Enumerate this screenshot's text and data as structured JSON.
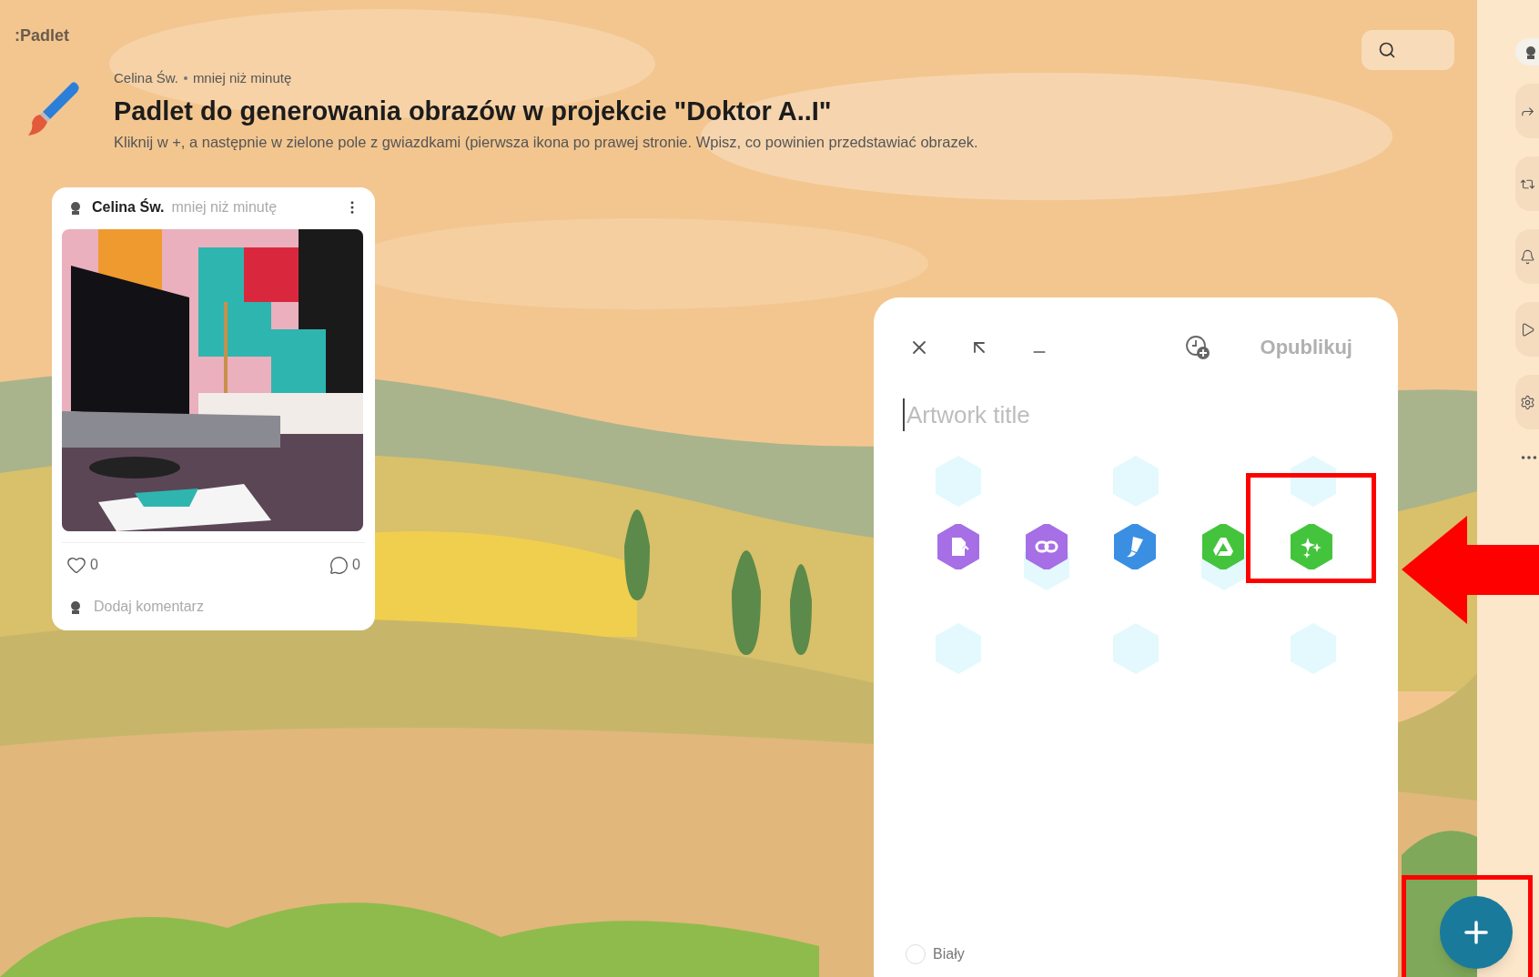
{
  "logo": ":Padlet",
  "header": {
    "author": "Celina Św.",
    "time": "mniej niż minutę",
    "title": "Padlet do generowania obrazów w projekcie \"Doktor A..I\"",
    "description": "Kliknij w +, a następnie w zielone pole z gwiazdkami (pierwsza ikona po prawej stronie. Wpisz, co powinien przedstawiać obrazek."
  },
  "posts": [
    {
      "author": "Celina Św.",
      "time": "mniej niż minutę",
      "likes": "0",
      "comments": "0",
      "comment_placeholder": "Dodaj komentarz"
    }
  ],
  "composer": {
    "publish": {
      "label": "Opublikuj",
      "disabled": true
    },
    "title_field": {
      "placeholder": "Artwork title"
    },
    "attachments": [
      {
        "kind": "upload",
        "color": "#a66fe6",
        "highlighted": false
      },
      {
        "kind": "link",
        "color": "#a66fe6",
        "highlighted": false
      },
      {
        "kind": "draw",
        "color": "#3a8fe3",
        "highlighted": false
      },
      {
        "kind": "drive",
        "color": "#44c43c",
        "highlighted": false
      },
      {
        "kind": "ai",
        "color": "#44c43c",
        "highlighted": true
      }
    ],
    "color_option": {
      "label": "Biały",
      "selected": false
    }
  },
  "sidebar": {
    "items": [
      {
        "kind": "avatar"
      },
      {
        "kind": "share"
      },
      {
        "kind": "remix"
      },
      {
        "kind": "notifications"
      },
      {
        "kind": "slideshow"
      },
      {
        "kind": "settings"
      },
      {
        "kind": "more"
      }
    ]
  },
  "add_button": {
    "highlighted": true
  }
}
